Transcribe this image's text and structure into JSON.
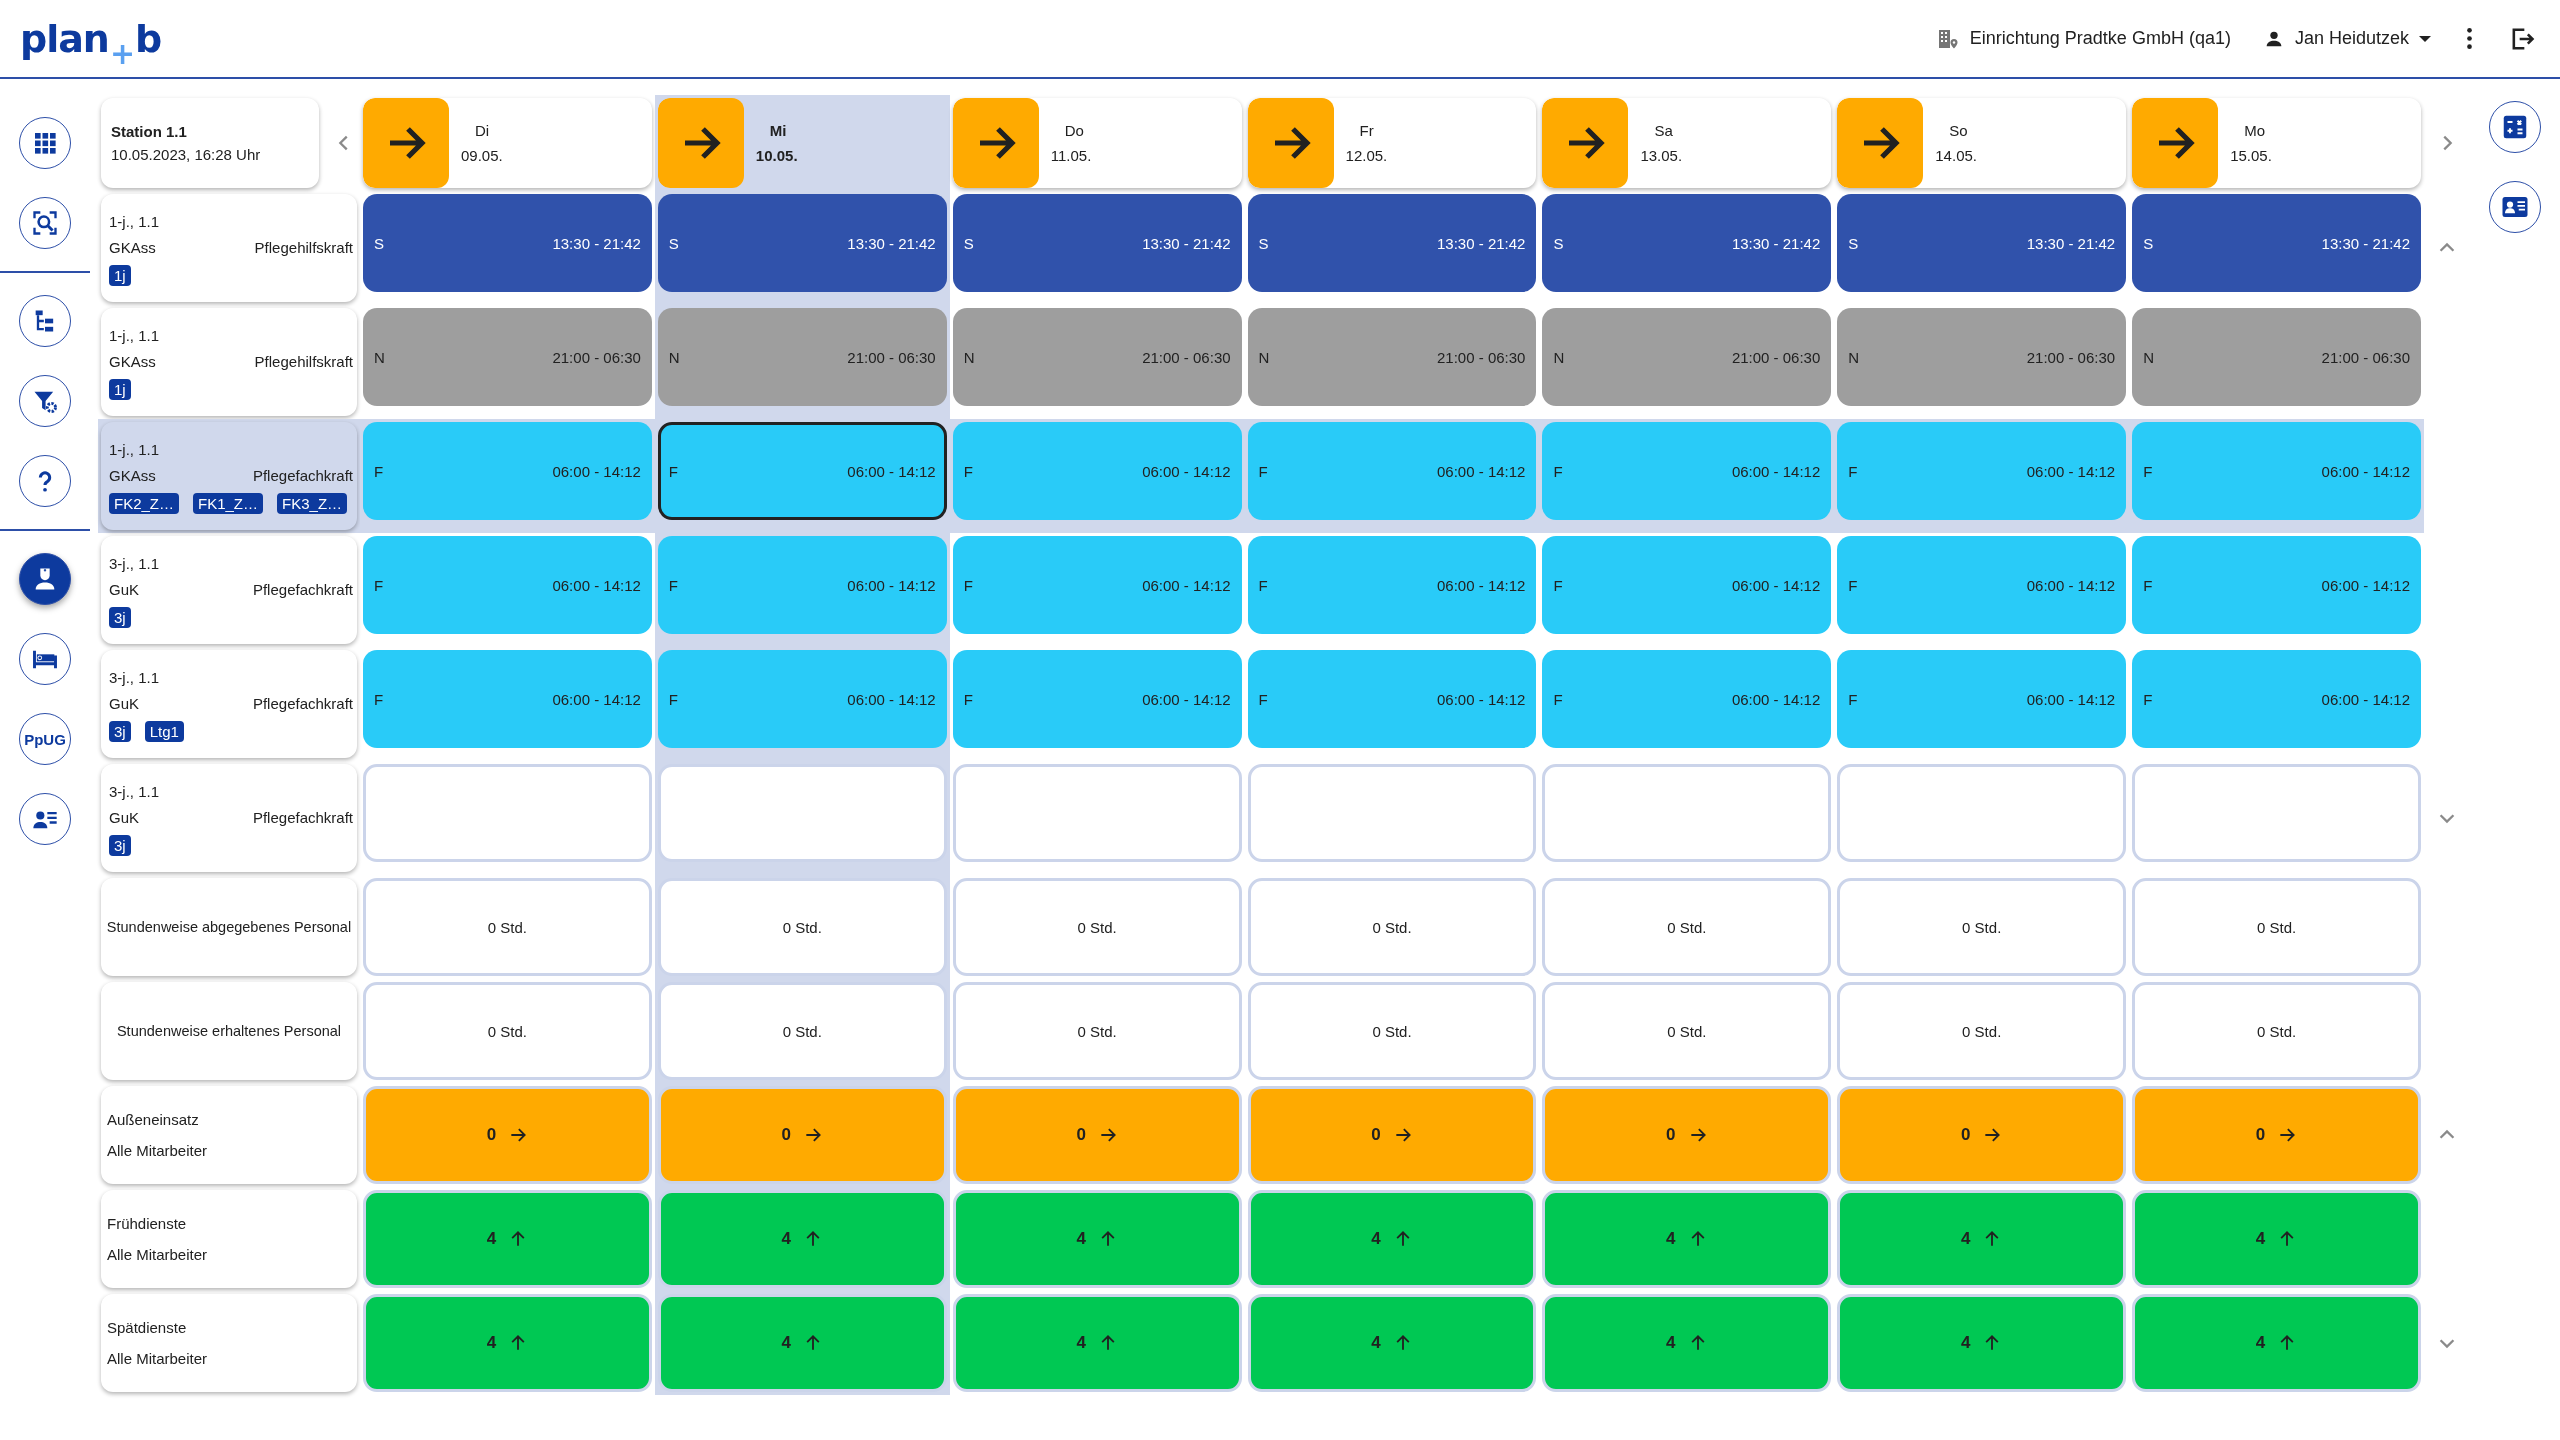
{
  "logo": {
    "left": "plan",
    "mark": "+",
    "right": "b"
  },
  "topbar": {
    "facility": "Einrichtung Pradtke GmbH (qa1)",
    "user": "Jan Heidutzek"
  },
  "rail_groups": [
    [
      {
        "kind": "apps",
        "selected": false
      },
      {
        "kind": "zoom",
        "selected": false
      }
    ],
    [
      {
        "kind": "tree",
        "selected": false
      },
      {
        "kind": "filter",
        "selected": false
      },
      {
        "kind": "help",
        "selected": false
      }
    ],
    [
      {
        "kind": "nurse",
        "selected": true
      },
      {
        "kind": "bed",
        "selected": false
      },
      {
        "kind": "text",
        "label": "PpUG",
        "selected": false
      },
      {
        "kind": "contacts",
        "selected": false
      }
    ]
  ],
  "right_rail": [
    {
      "kind": "calculator"
    },
    {
      "kind": "id-card"
    }
  ],
  "station": {
    "name": "Station 1.1",
    "timestamp": "10.05.2023, 16:28 Uhr"
  },
  "days": [
    {
      "weekday": "Di",
      "date": "09.05.",
      "selected": false
    },
    {
      "weekday": "Mi",
      "date": "10.05.",
      "selected": true
    },
    {
      "weekday": "Do",
      "date": "11.05.",
      "selected": false
    },
    {
      "weekday": "Fr",
      "date": "12.05.",
      "selected": false
    },
    {
      "weekday": "Sa",
      "date": "13.05.",
      "selected": false
    },
    {
      "weekday": "So",
      "date": "14.05.",
      "selected": false
    },
    {
      "weekday": "Mo",
      "date": "15.05.",
      "selected": false
    }
  ],
  "employees": [
    {
      "line1": "1-j., 1.1",
      "qualification": "GKAss",
      "role": "Pflegehilfskraft",
      "tags": [
        "1j"
      ],
      "selected": false,
      "scroll_up": true,
      "scroll_down": false,
      "shifts": [
        {
          "kind": "late",
          "code": "S",
          "time": "13:30 - 21:42",
          "selected": false
        },
        {
          "kind": "late",
          "code": "S",
          "time": "13:30 - 21:42",
          "selected": false
        },
        {
          "kind": "late",
          "code": "S",
          "time": "13:30 - 21:42",
          "selected": false
        },
        {
          "kind": "late",
          "code": "S",
          "time": "13:30 - 21:42",
          "selected": false
        },
        {
          "kind": "late",
          "code": "S",
          "time": "13:30 - 21:42",
          "selected": false
        },
        {
          "kind": "late",
          "code": "S",
          "time": "13:30 - 21:42",
          "selected": false
        },
        {
          "kind": "late",
          "code": "S",
          "time": "13:30 - 21:42",
          "selected": false
        }
      ]
    },
    {
      "line1": "1-j., 1.1",
      "qualification": "GKAss",
      "role": "Pflegehilfskraft",
      "tags": [
        "1j"
      ],
      "selected": false,
      "scroll_up": false,
      "scroll_down": false,
      "shifts": [
        {
          "kind": "night",
          "code": "N",
          "time": "21:00 - 06:30",
          "selected": false
        },
        {
          "kind": "night",
          "code": "N",
          "time": "21:00 - 06:30",
          "selected": false
        },
        {
          "kind": "night",
          "code": "N",
          "time": "21:00 - 06:30",
          "selected": false
        },
        {
          "kind": "night",
          "code": "N",
          "time": "21:00 - 06:30",
          "selected": false
        },
        {
          "kind": "night",
          "code": "N",
          "time": "21:00 - 06:30",
          "selected": false
        },
        {
          "kind": "night",
          "code": "N",
          "time": "21:00 - 06:30",
          "selected": false
        },
        {
          "kind": "night",
          "code": "N",
          "time": "21:00 - 06:30",
          "selected": false
        }
      ]
    },
    {
      "line1": "1-j., 1.1",
      "qualification": "GKAss",
      "role": "Pflegefachkraft",
      "tags": [
        "FK2_Z…",
        "FK1_Z…",
        "FK3_Z…"
      ],
      "selected": true,
      "scroll_up": false,
      "scroll_down": false,
      "shifts": [
        {
          "kind": "early",
          "code": "F",
          "time": "06:00 - 14:12",
          "selected": false
        },
        {
          "kind": "early",
          "code": "F",
          "time": "06:00 - 14:12",
          "selected": true
        },
        {
          "kind": "early",
          "code": "F",
          "time": "06:00 - 14:12",
          "selected": false
        },
        {
          "kind": "early",
          "code": "F",
          "time": "06:00 - 14:12",
          "selected": false
        },
        {
          "kind": "early",
          "code": "F",
          "time": "06:00 - 14:12",
          "selected": false
        },
        {
          "kind": "early",
          "code": "F",
          "time": "06:00 - 14:12",
          "selected": false
        },
        {
          "kind": "early",
          "code": "F",
          "time": "06:00 - 14:12",
          "selected": false
        }
      ]
    },
    {
      "line1": "3-j., 1.1",
      "qualification": "GuK",
      "role": "Pflegefachkraft",
      "tags": [
        "3j"
      ],
      "selected": false,
      "scroll_up": false,
      "scroll_down": false,
      "shifts": [
        {
          "kind": "early",
          "code": "F",
          "time": "06:00 - 14:12",
          "selected": false
        },
        {
          "kind": "early",
          "code": "F",
          "time": "06:00 - 14:12",
          "selected": false
        },
        {
          "kind": "early",
          "code": "F",
          "time": "06:00 - 14:12",
          "selected": false
        },
        {
          "kind": "early",
          "code": "F",
          "time": "06:00 - 14:12",
          "selected": false
        },
        {
          "kind": "early",
          "code": "F",
          "time": "06:00 - 14:12",
          "selected": false
        },
        {
          "kind": "early",
          "code": "F",
          "time": "06:00 - 14:12",
          "selected": false
        },
        {
          "kind": "early",
          "code": "F",
          "time": "06:00 - 14:12",
          "selected": false
        }
      ]
    },
    {
      "line1": "3-j., 1.1",
      "qualification": "GuK",
      "role": "Pflegefachkraft",
      "tags": [
        "3j",
        "Ltg1"
      ],
      "selected": false,
      "scroll_up": false,
      "scroll_down": false,
      "shifts": [
        {
          "kind": "early",
          "code": "F",
          "time": "06:00 - 14:12",
          "selected": false
        },
        {
          "kind": "early",
          "code": "F",
          "time": "06:00 - 14:12",
          "selected": false
        },
        {
          "kind": "early",
          "code": "F",
          "time": "06:00 - 14:12",
          "selected": false
        },
        {
          "kind": "early",
          "code": "F",
          "time": "06:00 - 14:12",
          "selected": false
        },
        {
          "kind": "early",
          "code": "F",
          "time": "06:00 - 14:12",
          "selected": false
        },
        {
          "kind": "early",
          "code": "F",
          "time": "06:00 - 14:12",
          "selected": false
        },
        {
          "kind": "early",
          "code": "F",
          "time": "06:00 - 14:12",
          "selected": false
        }
      ]
    },
    {
      "line1": "3-j., 1.1",
      "qualification": "GuK",
      "role": "Pflegefachkraft",
      "tags": [
        "3j"
      ],
      "selected": false,
      "scroll_up": false,
      "scroll_down": true,
      "shifts": [
        {
          "kind": "empty",
          "selected": false
        },
        {
          "kind": "empty",
          "selected": false
        },
        {
          "kind": "empty",
          "selected": false
        },
        {
          "kind": "empty",
          "selected": false
        },
        {
          "kind": "empty",
          "selected": false
        },
        {
          "kind": "empty",
          "selected": false
        },
        {
          "kind": "empty",
          "selected": false
        }
      ]
    }
  ],
  "summaries": [
    {
      "kind": "hours",
      "title": "Stundenweise abgegebenes Personal",
      "scroll_up": false,
      "scroll_down": false,
      "cells": [
        {
          "value": "0 Std."
        },
        {
          "value": "0 Std."
        },
        {
          "value": "0 Std."
        },
        {
          "value": "0 Std."
        },
        {
          "value": "0 Std."
        },
        {
          "value": "0 Std."
        },
        {
          "value": "0 Std."
        }
      ]
    },
    {
      "kind": "hours",
      "title": "Stundenweise erhaltenes Personal",
      "scroll_up": false,
      "scroll_down": false,
      "cells": [
        {
          "value": "0 Std."
        },
        {
          "value": "0 Std."
        },
        {
          "value": "0 Std."
        },
        {
          "value": "0 Std."
        },
        {
          "value": "0 Std."
        },
        {
          "value": "0 Std."
        },
        {
          "value": "0 Std."
        }
      ]
    },
    {
      "kind": "count",
      "title": "Außeneinsatz",
      "subtitle": "Alle Mitarbeiter",
      "scroll_up": true,
      "scroll_down": false,
      "cells": [
        {
          "value": "0",
          "color": "#ffaa00",
          "kind": "right"
        },
        {
          "value": "0",
          "color": "#ffaa00",
          "kind": "right"
        },
        {
          "value": "0",
          "color": "#ffaa00",
          "kind": "right"
        },
        {
          "value": "0",
          "color": "#ffaa00",
          "kind": "right"
        },
        {
          "value": "0",
          "color": "#ffaa00",
          "kind": "right"
        },
        {
          "value": "0",
          "color": "#ffaa00",
          "kind": "right"
        },
        {
          "value": "0",
          "color": "#ffaa00",
          "kind": "right"
        }
      ]
    },
    {
      "kind": "count",
      "title": "Frühdienste",
      "subtitle": "Alle Mitarbeiter",
      "scroll_up": false,
      "scroll_down": false,
      "cells": [
        {
          "value": "4",
          "color": "#00c853",
          "kind": "up"
        },
        {
          "value": "4",
          "color": "#00c853",
          "kind": "up"
        },
        {
          "value": "4",
          "color": "#00c853",
          "kind": "up"
        },
        {
          "value": "4",
          "color": "#00c853",
          "kind": "up"
        },
        {
          "value": "4",
          "color": "#00c853",
          "kind": "up"
        },
        {
          "value": "4",
          "color": "#00c853",
          "kind": "up"
        },
        {
          "value": "4",
          "color": "#00c853",
          "kind": "up"
        }
      ]
    },
    {
      "kind": "count",
      "title": "Spätdienste",
      "subtitle": "Alle Mitarbeiter",
      "scroll_up": false,
      "scroll_down": true,
      "cells": [
        {
          "value": "4",
          "color": "#00c853",
          "kind": "up"
        },
        {
          "value": "4",
          "color": "#00c853",
          "kind": "up"
        },
        {
          "value": "4",
          "color": "#00c853",
          "kind": "up"
        },
        {
          "value": "4",
          "color": "#00c853",
          "kind": "up"
        },
        {
          "value": "4",
          "color": "#00c853",
          "kind": "up"
        },
        {
          "value": "4",
          "color": "#00c853",
          "kind": "up"
        },
        {
          "value": "4",
          "color": "#00c853",
          "kind": "up"
        }
      ]
    }
  ]
}
